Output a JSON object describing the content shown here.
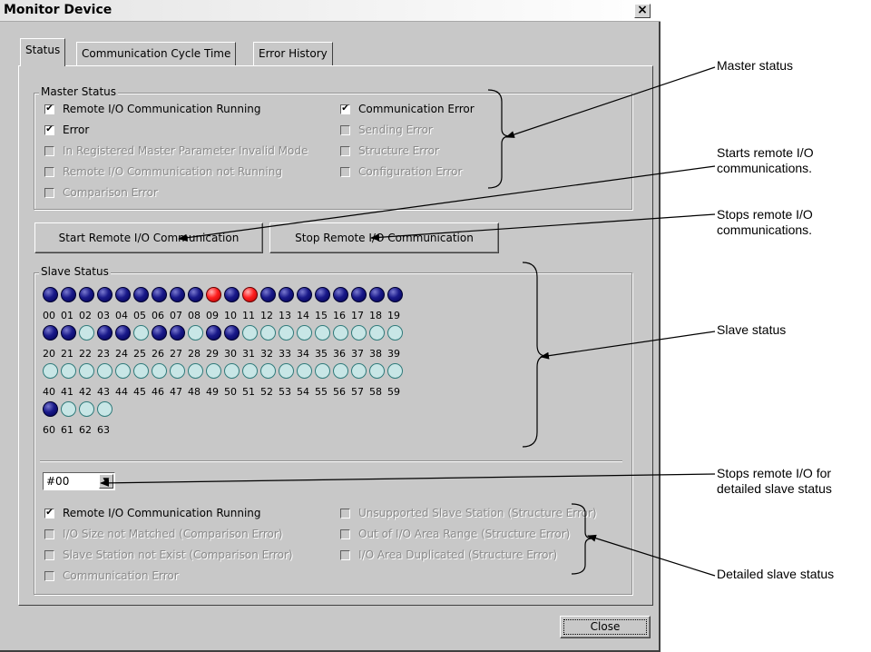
{
  "window": {
    "title": "Monitor Device"
  },
  "tabs": [
    {
      "label": "Status"
    },
    {
      "label": "Communication Cycle Time"
    },
    {
      "label": "Error History"
    }
  ],
  "master_status": {
    "label": "Master Status",
    "items": [
      {
        "label": "Remote I/O Communication Running",
        "checked": true,
        "enabled": true
      },
      {
        "label": "Error",
        "checked": true,
        "enabled": true
      },
      {
        "label": "In Registered Master Parameter Invalid Mode",
        "checked": false,
        "enabled": false
      },
      {
        "label": "Remote I/O Communication not Running",
        "checked": false,
        "enabled": false
      },
      {
        "label": "Comparison Error",
        "checked": false,
        "enabled": false
      },
      {
        "label": "Communication Error",
        "checked": true,
        "enabled": true
      },
      {
        "label": "Sending Error",
        "checked": false,
        "enabled": false
      },
      {
        "label": "Structure Error",
        "checked": false,
        "enabled": false
      },
      {
        "label": "Configuration Error",
        "checked": false,
        "enabled": false
      }
    ]
  },
  "buttons": {
    "start": "Start Remote I/O Communication",
    "stop": "Stop Remote I/O Communication",
    "close": "Close"
  },
  "slave_status": {
    "label": "Slave Status",
    "rows": [
      {
        "numbers": [
          "00",
          "01",
          "02",
          "03",
          "04",
          "05",
          "06",
          "07",
          "08",
          "09",
          "10",
          "11",
          "12",
          "13",
          "14",
          "15",
          "16",
          "17",
          "18",
          "19"
        ],
        "states": [
          "on",
          "on",
          "on",
          "on",
          "on",
          "on",
          "on",
          "on",
          "on",
          "err",
          "on",
          "err",
          "on",
          "on",
          "on",
          "on",
          "on",
          "on",
          "on",
          "on"
        ]
      },
      {
        "numbers": [
          "20",
          "21",
          "22",
          "23",
          "24",
          "25",
          "26",
          "27",
          "28",
          "29",
          "30",
          "31",
          "32",
          "33",
          "34",
          "35",
          "36",
          "37",
          "38",
          "39"
        ],
        "states": [
          "on",
          "on",
          "off",
          "on",
          "on",
          "off",
          "on",
          "on",
          "off",
          "on",
          "on",
          "off",
          "off",
          "off",
          "off",
          "off",
          "off",
          "off",
          "off",
          "off"
        ]
      },
      {
        "numbers": [
          "40",
          "41",
          "42",
          "43",
          "44",
          "45",
          "46",
          "47",
          "48",
          "49",
          "50",
          "51",
          "52",
          "53",
          "54",
          "55",
          "56",
          "57",
          "58",
          "59"
        ],
        "states": [
          "off",
          "off",
          "off",
          "off",
          "off",
          "off",
          "off",
          "off",
          "off",
          "off",
          "off",
          "off",
          "off",
          "off",
          "off",
          "off",
          "off",
          "off",
          "off",
          "off"
        ]
      },
      {
        "numbers": [
          "60",
          "61",
          "62",
          "63"
        ],
        "states": [
          "on",
          "off",
          "off",
          "off"
        ]
      }
    ]
  },
  "station_select": {
    "value": "#00"
  },
  "detail_status": {
    "items": [
      {
        "label": "Remote I/O Communication Running",
        "checked": true,
        "enabled": true
      },
      {
        "label": "I/O Size not Matched (Comparison Error)",
        "checked": false,
        "enabled": false
      },
      {
        "label": "Slave Station not Exist (Comparison Error)",
        "checked": false,
        "enabled": false
      },
      {
        "label": "Communication Error",
        "checked": false,
        "enabled": false
      },
      {
        "label": "Unsupported Slave Station (Structure Error)",
        "checked": false,
        "enabled": false
      },
      {
        "label": "Out of I/O Area Range (Structure Error)",
        "checked": false,
        "enabled": false
      },
      {
        "label": "I/O Area Duplicated (Structure Error)",
        "checked": false,
        "enabled": false
      }
    ]
  },
  "annotations": {
    "master": "Master status",
    "start_1": "Starts remote I/O",
    "start_2": "communications.",
    "stop_1": "Stops remote I/O",
    "stop_2": "communications.",
    "slave": "Slave status",
    "detail_sel_1": "Stops remote I/O for",
    "detail_sel_2": "detailed slave status",
    "detail": "Detailed slave status"
  },
  "colors": {
    "active": "#1a1a8a",
    "error": "#ff2020",
    "inactive": "#c8e6e6"
  },
  "icons": {
    "close": "close-icon",
    "checkmark": "checkmark-icon",
    "dropdown": "chevron-down-icon"
  }
}
